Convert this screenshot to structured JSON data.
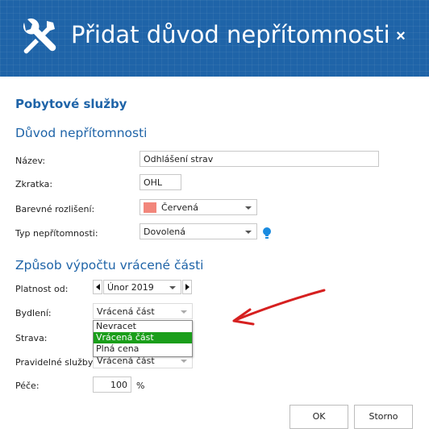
{
  "header": {
    "title": "Přidat důvod nepřítomnosti",
    "close": "×",
    "icon": "tools-icon",
    "background": "#1f64a8"
  },
  "section": {
    "title": "Pobytové služby"
  },
  "reason": {
    "heading": "Důvod nepřítomnosti",
    "name_label": "Název:",
    "name_value": "Odhlášení strav",
    "short_label": "Zkratka:",
    "short_value": "OHL",
    "color_label": "Barevné rozlišení:",
    "color_value": "Červená",
    "color_swatch": "#f2867b",
    "type_label": "Typ nepřítomnosti:",
    "type_value": "Dovolená",
    "type_icon": "lightbulb-icon"
  },
  "refund": {
    "heading": "Způsob výpočtu vrácené části",
    "valid_label": "Platnost od:",
    "valid_value": "Únor 2019",
    "housing_label": "Bydlení:",
    "housing_value": "Vrácená část",
    "housing_options": [
      "Nevracet",
      "Vrácená část",
      "Plná cena"
    ],
    "housing_selected_index": 1,
    "food_label": "Strava:",
    "regular_label": "Pravidelné služby:",
    "regular_value": "Vrácená část",
    "care_label": "Péče:",
    "care_value": "100",
    "care_unit": "%"
  },
  "buttons": {
    "ok": "OK",
    "cancel": "Storno"
  },
  "colors": {
    "accent": "#1f64a8",
    "selected": "#1a9e1a",
    "annotation_arrow": "#d62020"
  }
}
